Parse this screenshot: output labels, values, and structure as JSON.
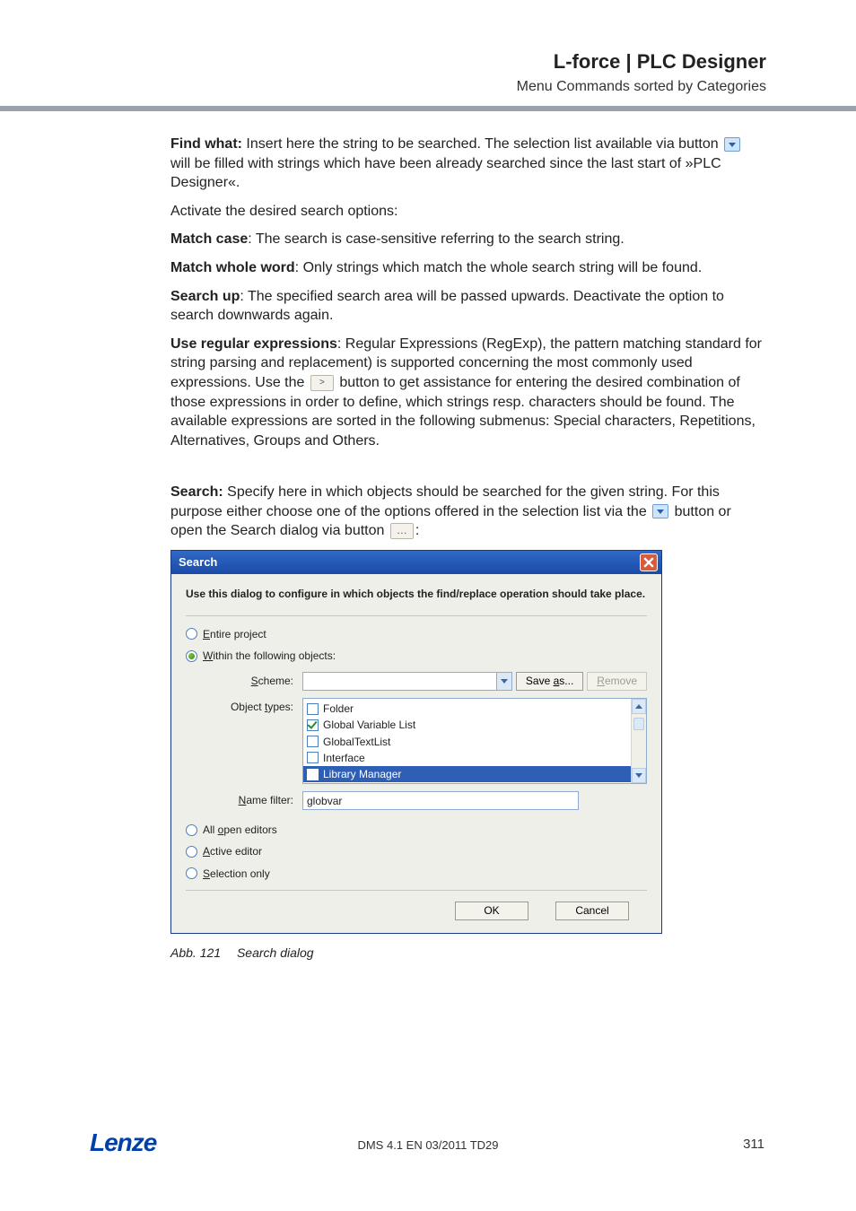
{
  "header": {
    "title": "L-force | PLC Designer",
    "subtitle": "Menu Commands sorted by Categories"
  },
  "body": {
    "findWhatLabel": "Find what:",
    "findWhat1": " Insert here the string to be searched. The selection list available via button ",
    "findWhat2": "will be filled with strings which have been already searched since the last start of »PLC Designer«.",
    "activate": "Activate the desired search options:",
    "matchCaseLabel": "Match case",
    "matchCase": ": The search is case-sensitive referring to the search string.",
    "matchWholeLabel": "Match whole word",
    "matchWhole": ": Only strings which match the whole search string will be found.",
    "searchUpLabel": "Search up",
    "searchUp": ": The specified search area will be passed upwards. Deactivate the option to search downwards again.",
    "regexLabel": "Use regular expressions",
    "regex1": ": Regular Expressions (RegExp), the pattern matching standard for string parsing and replacement) is supported concerning the most commonly used expressions. Use the ",
    "regex2": "button to get assistance for entering the desired combination of those expressions in order to define, which strings resp. characters should be found. The available expressions are sorted in the following submenus: Special characters, Repetitions, Alternatives, Groups and Others.",
    "searchLabel": "Search:",
    "search1": " Specify here in which objects should be searched for the given string. For this purpose either choose one of the options offered in the selection list via the ",
    "search2": "button or open the Search dialog via button ",
    "search3": ":"
  },
  "dialog": {
    "title": "Search",
    "instruction": "Use this dialog to configure in which objects the find/replace operation should take place.",
    "entireProject": "Entire project",
    "withinFollowing": "Within the following objects:",
    "schemeLabel": "Scheme:",
    "saveAs": "Save as...",
    "remove": "Remove",
    "objectTypesLabel": "Object types:",
    "types": {
      "folder": "Folder",
      "gvl": "Global Variable List",
      "gtl": "GlobalTextList",
      "iface": "Interface",
      "libmgr": "Library Manager"
    },
    "nameFilterLabel": "Name filter:",
    "nameFilterValue": "globvar",
    "allOpen": "All open editors",
    "activeEditor": "Active editor",
    "selectionOnly": "Selection only",
    "ok": "OK",
    "cancel": "Cancel"
  },
  "caption": {
    "label": "Abb. 121",
    "text": "Search dialog"
  },
  "footer": {
    "logo": "Lenze",
    "center": "DMS 4.1 EN 03/2011 TD29",
    "page": "311"
  }
}
